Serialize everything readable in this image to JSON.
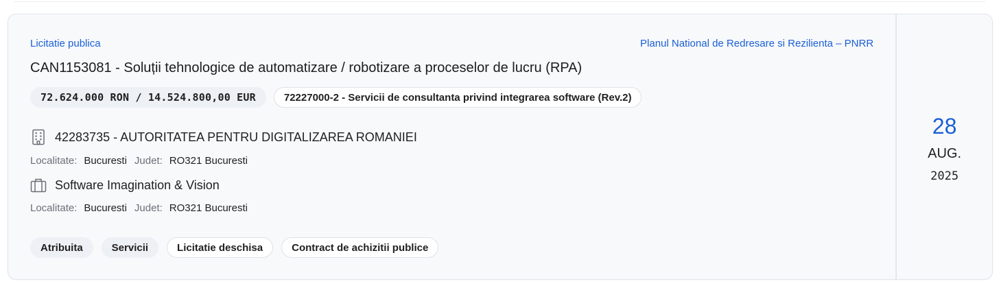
{
  "notice": {
    "procedure_type": "Licitatie publica",
    "program": "Planul National de Redresare si Rezilienta – PNRR",
    "title": "CAN1153081 - Soluții tehnologice de automatizare / robotizare a proceselor de lucru (RPA)",
    "value_chip": "72.624.000 RON / 14.524.800,00 EUR",
    "cpv_chip": "72227000-2 - Servicii de consultanta privind integrarea software (Rev.2)"
  },
  "authority": {
    "icon": "building-icon",
    "name": "42283735 - AUTORITATEA PENTRU DIGITALIZAREA ROMANIEI",
    "locality_label": "Localitate:",
    "locality": "Bucuresti",
    "county_label": "Judet:",
    "county": "RO321 Bucuresti"
  },
  "winner": {
    "icon": "briefcase-icon",
    "name": "Software Imagination & Vision",
    "locality_label": "Localitate:",
    "locality": "Bucuresti",
    "county_label": "Judet:",
    "county": "RO321 Bucuresti"
  },
  "tags": [
    "Atribuita",
    "Servicii",
    "Licitatie deschisa",
    "Contract de achizitii publice"
  ],
  "date": {
    "day": "28",
    "month": "AUG.",
    "year": "2025"
  },
  "colors": {
    "accent": "#1a5fd6",
    "card_bg": "#f8f9fb",
    "chip_bg": "#edf0f4"
  }
}
